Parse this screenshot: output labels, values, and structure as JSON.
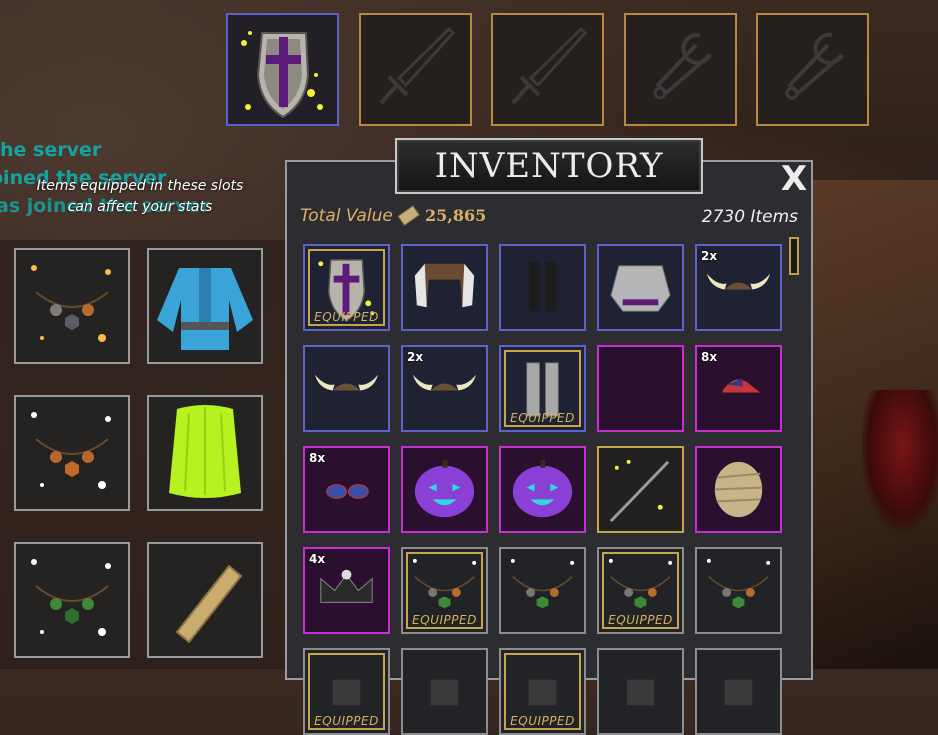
{
  "chat": {
    "line1": "he server",
    "line2": "oined the server",
    "line3": "as joined the server"
  },
  "hint": "Items equipped in these slots can affect your stats",
  "top_slots": [
    {
      "icon": "shield-icon",
      "selected": true
    },
    {
      "icon": "sword-icon",
      "selected": false
    },
    {
      "icon": "sword-icon",
      "selected": false
    },
    {
      "icon": "wrench-icon",
      "selected": false
    },
    {
      "icon": "wrench-icon",
      "selected": false
    }
  ],
  "side_slots": [
    {
      "icon": "necklace-icon"
    },
    {
      "icon": "tunic-icon"
    },
    {
      "icon": "necklace-icon"
    },
    {
      "icon": "cape-icon"
    },
    {
      "icon": "necklace-icon"
    },
    {
      "icon": "scroll-icon"
    }
  ],
  "inventory": {
    "title": "INVENTORY",
    "close": "X",
    "total_label": "Total Value",
    "total_value": "25,865",
    "items_count": "2730 Items",
    "equipped_label": "EQUIPPED",
    "rows": [
      [
        {
          "icon": "shield-icon",
          "qty": "",
          "equipped": true,
          "rarity": "blue"
        },
        {
          "icon": "vest-icon",
          "qty": "",
          "equipped": false,
          "rarity": "blue"
        },
        {
          "icon": "boots-icon",
          "qty": "",
          "equipped": false,
          "rarity": "blue"
        },
        {
          "icon": "armor-icon",
          "qty": "",
          "equipped": false,
          "rarity": "blue"
        },
        {
          "icon": "horned-helmet-icon",
          "qty": "2x",
          "equipped": false,
          "rarity": "blue"
        }
      ],
      [
        {
          "icon": "horned-helmet-icon",
          "qty": "",
          "equipped": false,
          "rarity": "blue"
        },
        {
          "icon": "horned-helmet-icon",
          "qty": "2x",
          "equipped": false,
          "rarity": "blue"
        },
        {
          "icon": "leg-armor-icon",
          "qty": "",
          "equipped": true,
          "rarity": "blue"
        },
        {
          "icon": "empty-icon",
          "qty": "",
          "equipped": false,
          "rarity": "purple"
        },
        {
          "icon": "cap-icon",
          "qty": "8x",
          "equipped": false,
          "rarity": "purple"
        }
      ],
      [
        {
          "icon": "sunglasses-icon",
          "qty": "8x",
          "equipped": false,
          "rarity": "purple"
        },
        {
          "icon": "pumpkin-icon",
          "qty": "",
          "equipped": false,
          "rarity": "purple"
        },
        {
          "icon": "pumpkin-icon",
          "qty": "",
          "equipped": false,
          "rarity": "purple"
        },
        {
          "icon": "spear-icon",
          "qty": "",
          "equipped": false,
          "rarity": "gold"
        },
        {
          "icon": "mummy-head-icon",
          "qty": "",
          "equipped": false,
          "rarity": "purple"
        }
      ],
      [
        {
          "icon": "crown-icon",
          "qty": "4x",
          "equipped": false,
          "rarity": "purple"
        },
        {
          "icon": "necklace-icon",
          "qty": "",
          "equipped": true,
          "rarity": "gray"
        },
        {
          "icon": "necklace-icon",
          "qty": "",
          "equipped": false,
          "rarity": "gray"
        },
        {
          "icon": "necklace-icon",
          "qty": "",
          "equipped": true,
          "rarity": "gray"
        },
        {
          "icon": "necklace-icon",
          "qty": "",
          "equipped": false,
          "rarity": "gray"
        }
      ],
      [
        {
          "icon": "item-icon",
          "qty": "",
          "equipped": true,
          "rarity": "gray"
        },
        {
          "icon": "item-icon",
          "qty": "",
          "equipped": false,
          "rarity": "gray"
        },
        {
          "icon": "item-icon",
          "qty": "",
          "equipped": true,
          "rarity": "gray"
        },
        {
          "icon": "item-icon",
          "qty": "",
          "equipped": false,
          "rarity": "gray"
        },
        {
          "icon": "item-icon",
          "qty": "",
          "equipped": false,
          "rarity": "gray"
        }
      ]
    ]
  },
  "colors": {
    "chat": "#14a3a1",
    "gold": "#c8a44d",
    "rare_blue": "#5e63c9",
    "epic_purple": "#c62fd1",
    "common_gray": "#8d8d8d"
  }
}
